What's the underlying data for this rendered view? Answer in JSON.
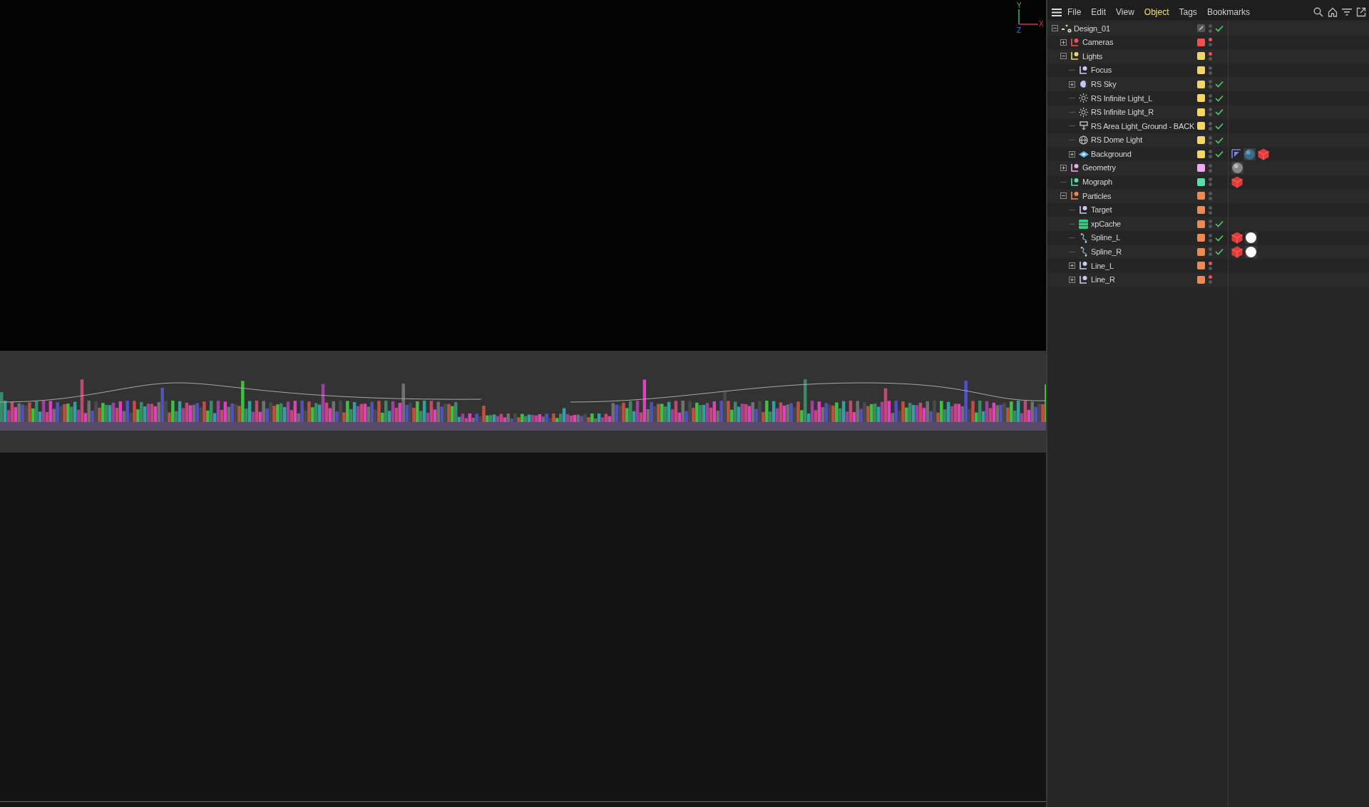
{
  "viewport": {
    "axis_labels": {
      "y": "Y",
      "z": "Z",
      "x": "X"
    }
  },
  "object_manager": {
    "menu": [
      {
        "label": "File",
        "selected": false
      },
      {
        "label": "Edit",
        "selected": false
      },
      {
        "label": "View",
        "selected": false
      },
      {
        "label": "Object",
        "selected": true
      },
      {
        "label": "Tags",
        "selected": false
      },
      {
        "label": "Bookmarks",
        "selected": false
      }
    ],
    "tree": [
      {
        "name": "Design_01",
        "kind": "scene",
        "expanded": true,
        "hidden_in_editor": false,
        "enabled": true,
        "children": [
          {
            "name": "Cameras",
            "kind": "null-layer",
            "color": "#f05050",
            "expanded": false,
            "hidden_in_editor": true,
            "enabled": false
          },
          {
            "name": "Lights",
            "kind": "null-layer",
            "color": "#f5d660",
            "expanded": true,
            "hidden_in_editor": true,
            "enabled": false,
            "children": [
              {
                "name": "Focus",
                "kind": "null",
                "color": "#f5d660",
                "hidden_in_editor": false,
                "enabled": false
              },
              {
                "name": "RS Sky",
                "kind": "sky",
                "color": "#f5d660",
                "expanded": false,
                "hidden_in_editor": false,
                "enabled": true
              },
              {
                "name": "RS Infinite Light_L",
                "kind": "infinite-light",
                "color": "#f5d660",
                "hidden_in_editor": false,
                "enabled": true
              },
              {
                "name": "RS Infinite Light_R",
                "kind": "infinite-light",
                "color": "#f5d660",
                "hidden_in_editor": false,
                "enabled": true
              },
              {
                "name": "RS Area Light_Ground - BACK",
                "kind": "area-light",
                "color": "#f5d660",
                "hidden_in_editor": false,
                "enabled": true
              },
              {
                "name": "RS Dome Light",
                "kind": "dome-light",
                "color": "#f5d660",
                "hidden_in_editor": false,
                "enabled": true
              },
              {
                "name": "Background",
                "kind": "plane",
                "color": "#f5d660",
                "expanded": false,
                "hidden_in_editor": false,
                "enabled": true,
                "tags": [
                  {
                    "kind": "display"
                  },
                  {
                    "kind": "material-blue"
                  },
                  {
                    "kind": "material-red"
                  }
                ]
              }
            ]
          },
          {
            "name": "Geometry",
            "kind": "null-layer",
            "color": "#eeaaf0",
            "expanded": false,
            "hidden_in_editor": false,
            "enabled": false,
            "tags": [
              {
                "kind": "material-grey"
              }
            ]
          },
          {
            "name": "Mograph",
            "kind": "null-layer",
            "color": "#50e0a8",
            "hidden_in_editor": false,
            "enabled": false,
            "tags": [
              {
                "kind": "material-red"
              }
            ]
          },
          {
            "name": "Particles",
            "kind": "null-layer",
            "color": "#f08850",
            "expanded": true,
            "hidden_in_editor": false,
            "enabled": false,
            "children": [
              {
                "name": "Target",
                "kind": "null",
                "color": "#f08850",
                "hidden_in_editor": false,
                "enabled": false
              },
              {
                "name": "xpCache",
                "kind": "cache",
                "color": "#f08850",
                "hidden_in_editor": false,
                "enabled": true
              },
              {
                "name": "Spline_L",
                "kind": "spline",
                "color": "#f08850",
                "hidden_in_editor": false,
                "enabled": true,
                "tags": [
                  {
                    "kind": "material-red"
                  },
                  {
                    "kind": "material-white"
                  }
                ]
              },
              {
                "name": "Spline_R",
                "kind": "spline",
                "color": "#f08850",
                "hidden_in_editor": false,
                "enabled": true,
                "tags": [
                  {
                    "kind": "material-red"
                  },
                  {
                    "kind": "material-white"
                  }
                ]
              },
              {
                "name": "Line_L",
                "kind": "null",
                "color": "#f08850",
                "expanded": false,
                "hidden_in_editor": true,
                "enabled": false
              },
              {
                "name": "Line_R",
                "kind": "null",
                "color": "#f08850",
                "expanded": false,
                "hidden_in_editor": true,
                "enabled": false
              }
            ]
          }
        ]
      }
    ]
  }
}
